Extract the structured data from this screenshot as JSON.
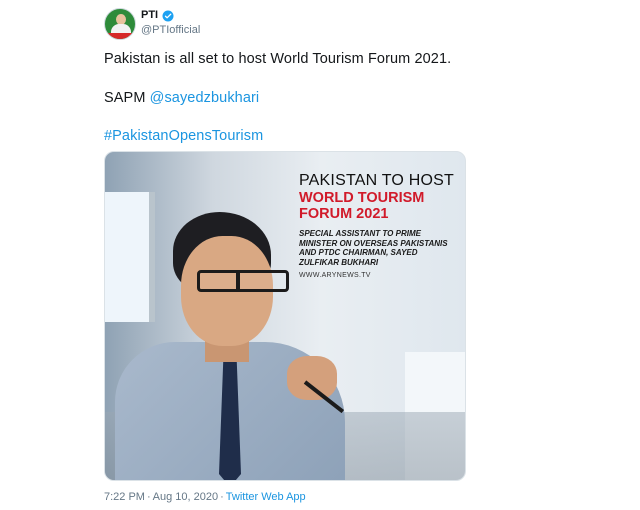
{
  "account": {
    "display_name": "PTI",
    "handle": "@PTIofficial",
    "verified": true,
    "avatar_colors": {
      "bg": "#2e8b3a",
      "band": "#d62828"
    }
  },
  "tweet": {
    "line1": "Pakistan is all set to host World Tourism Forum 2021.",
    "line2_prefix": "SAPM ",
    "line2_mention": "@sayedzbukhari",
    "line3_hashtag": "#PakistanOpensTourism",
    "link_color": "#1b95e0"
  },
  "media": {
    "headline": "PAKISTAN TO HOST",
    "headline_red": "WORLD TOURISM FORUM 2021",
    "subtext": "SPECIAL ASSISTANT TO PRIME MINISTER ON OVERSEAS PAKISTANIS AND PTDC CHAIRMAN, SAYED ZULFIKAR BUKHARI",
    "site": "WWW.ARYNEWS.TV",
    "accent_color": "#d11a2a"
  },
  "meta": {
    "time": "7:22 PM",
    "separator1": "·",
    "date": "Aug 10, 2020",
    "separator2": "·",
    "source": "Twitter Web App"
  }
}
